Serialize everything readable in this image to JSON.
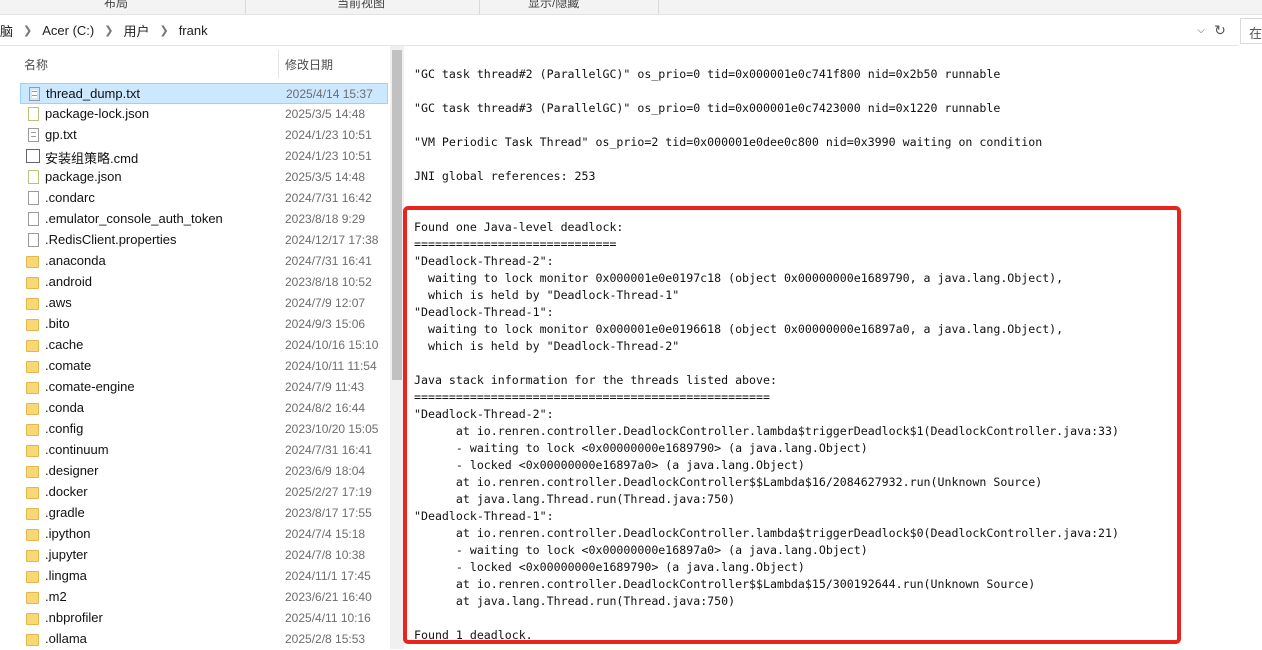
{
  "ribbon": {
    "groups": [
      "布局",
      "当前视图",
      "显示/隐藏"
    ]
  },
  "address": {
    "crumbs": [
      "脑",
      "Acer (C:)",
      "用户",
      "frank"
    ],
    "search_label": "在"
  },
  "columns": {
    "name": "名称",
    "modified": "修改日期"
  },
  "files": [
    {
      "name": "thread_dump.txt",
      "date": "2025/4/14 15:37",
      "type": "txt",
      "selected": true
    },
    {
      "name": "package-lock.json",
      "date": "2025/3/5 14:48",
      "type": "json"
    },
    {
      "name": "gp.txt",
      "date": "2024/1/23 10:51",
      "type": "txt"
    },
    {
      "name": "安装组策略.cmd",
      "date": "2024/1/23 10:51",
      "type": "cmd"
    },
    {
      "name": "package.json",
      "date": "2025/3/5 14:48",
      "type": "json"
    },
    {
      "name": ".condarc",
      "date": "2024/7/31 16:42",
      "type": "file"
    },
    {
      "name": ".emulator_console_auth_token",
      "date": "2023/8/18 9:29",
      "type": "file"
    },
    {
      "name": ".RedisClient.properties",
      "date": "2024/12/17 17:38",
      "type": "file"
    },
    {
      "name": ".anaconda",
      "date": "2024/7/31 16:41",
      "type": "folder"
    },
    {
      "name": ".android",
      "date": "2023/8/18 10:52",
      "type": "folder"
    },
    {
      "name": ".aws",
      "date": "2024/7/9 12:07",
      "type": "folder"
    },
    {
      "name": ".bito",
      "date": "2024/9/3 15:06",
      "type": "folder"
    },
    {
      "name": ".cache",
      "date": "2024/10/16 15:10",
      "type": "folder"
    },
    {
      "name": ".comate",
      "date": "2024/10/11 11:54",
      "type": "folder"
    },
    {
      "name": ".comate-engine",
      "date": "2024/7/9 11:43",
      "type": "folder"
    },
    {
      "name": ".conda",
      "date": "2024/8/2 16:44",
      "type": "folder"
    },
    {
      "name": ".config",
      "date": "2023/10/20 15:05",
      "type": "folder"
    },
    {
      "name": ".continuum",
      "date": "2024/7/31 16:41",
      "type": "folder"
    },
    {
      "name": ".designer",
      "date": "2023/6/9 18:04",
      "type": "folder"
    },
    {
      "name": ".docker",
      "date": "2025/2/27 17:19",
      "type": "folder"
    },
    {
      "name": ".gradle",
      "date": "2023/8/17 17:55",
      "type": "folder"
    },
    {
      "name": ".ipython",
      "date": "2024/7/4 15:18",
      "type": "folder"
    },
    {
      "name": ".jupyter",
      "date": "2024/7/8 10:38",
      "type": "folder"
    },
    {
      "name": ".lingma",
      "date": "2024/11/1 17:45",
      "type": "folder"
    },
    {
      "name": ".m2",
      "date": "2023/6/21 16:40",
      "type": "folder"
    },
    {
      "name": ".nbprofiler",
      "date": "2025/4/11 10:16",
      "type": "folder"
    },
    {
      "name": ".ollama",
      "date": "2025/2/8 15:53",
      "type": "folder"
    }
  ],
  "viewer": {
    "top_lines": [
      "\"GC task thread#2 (ParallelGC)\" os_prio=0 tid=0x000001e0c741f800 nid=0x2b50 runnable",
      "\"GC task thread#3 (ParallelGC)\" os_prio=0 tid=0x000001e0c7423000 nid=0x1220 runnable",
      "\"VM Periodic Task Thread\" os_prio=2 tid=0x000001e0dee0c800 nid=0x3990 waiting on condition",
      "JNI global references: 253"
    ],
    "deadlock_lines": [
      "Found one Java-level deadlock:",
      "=============================",
      "\"Deadlock-Thread-2\":",
      "  waiting to lock monitor 0x000001e0e0197c18 (object 0x00000000e1689790, a java.lang.Object),",
      "  which is held by \"Deadlock-Thread-1\"",
      "\"Deadlock-Thread-1\":",
      "  waiting to lock monitor 0x000001e0e0196618 (object 0x00000000e16897a0, a java.lang.Object),",
      "  which is held by \"Deadlock-Thread-2\"",
      "",
      "Java stack information for the threads listed above:",
      "===================================================",
      "\"Deadlock-Thread-2\":",
      "\tat io.renren.controller.DeadlockController.lambda$triggerDeadlock$1(DeadlockController.java:33)",
      "\t- waiting to lock <0x00000000e1689790> (a java.lang.Object)",
      "\t- locked <0x00000000e16897a0> (a java.lang.Object)",
      "\tat io.renren.controller.DeadlockController$$Lambda$16/2084627932.run(Unknown Source)",
      "\tat java.lang.Thread.run(Thread.java:750)",
      "\"Deadlock-Thread-1\":",
      "\tat io.renren.controller.DeadlockController.lambda$triggerDeadlock$0(DeadlockController.java:21)",
      "\t- waiting to lock <0x00000000e16897a0> (a java.lang.Object)",
      "\t- locked <0x00000000e1689790> (a java.lang.Object)",
      "\tat io.renren.controller.DeadlockController$$Lambda$15/300192644.run(Unknown Source)",
      "\tat java.lang.Thread.run(Thread.java:750)",
      "",
      "Found 1 deadlock."
    ]
  },
  "colors": {
    "selection": "#cce8ff",
    "highlight_border": "#e8241c",
    "folder": "#f8d775"
  }
}
